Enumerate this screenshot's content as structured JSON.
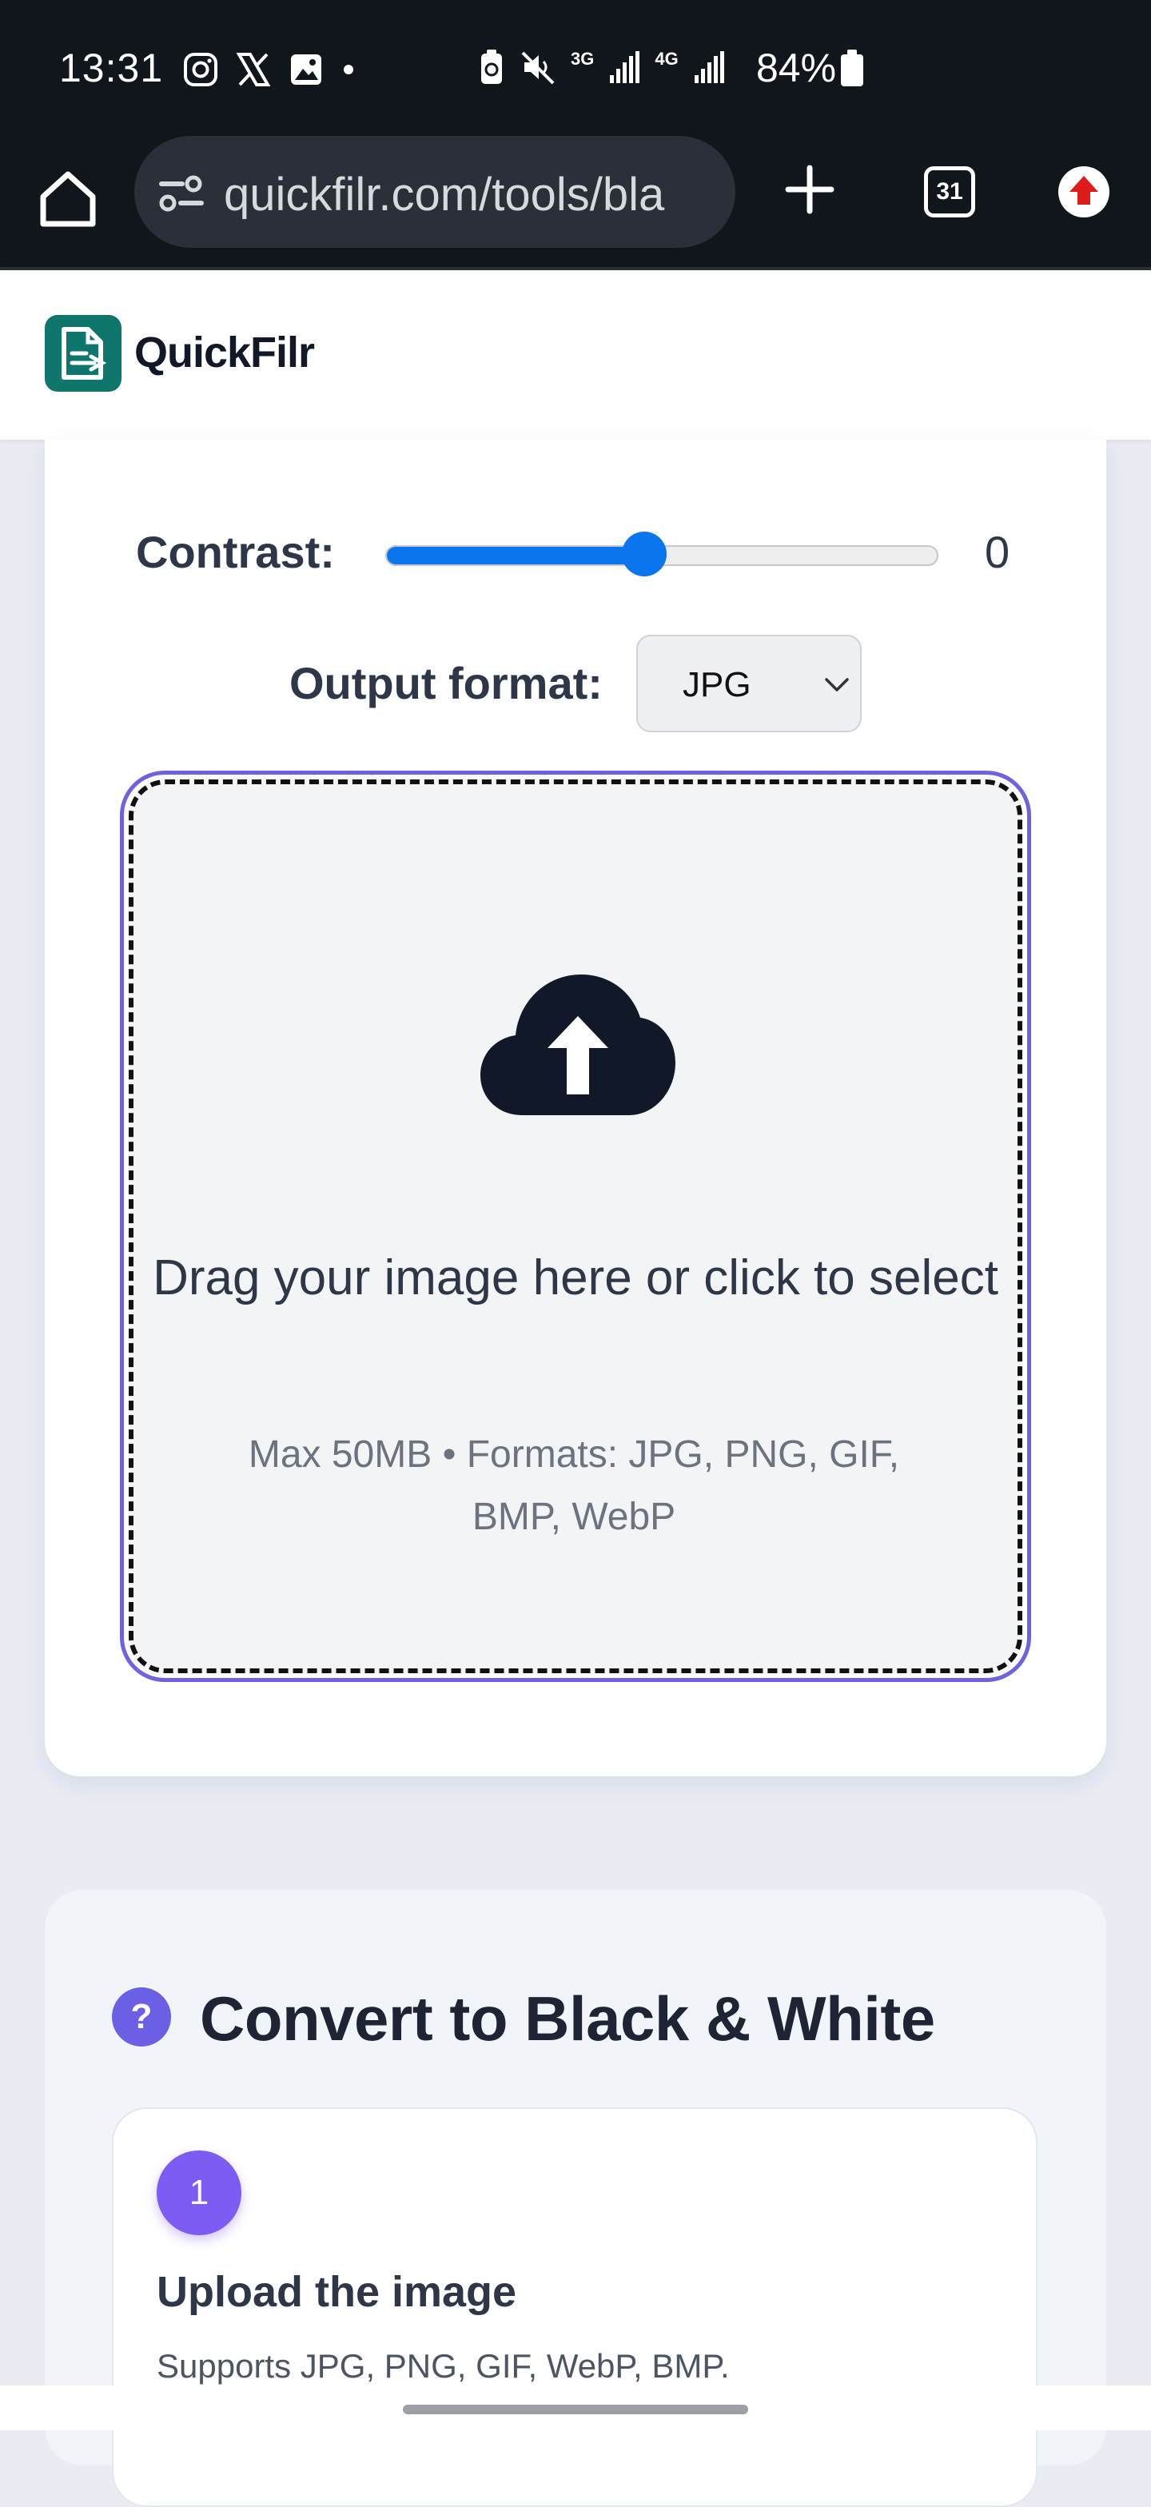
{
  "status_bar": {
    "time": "13:31",
    "battery": "84%",
    "network_3g": "3G",
    "network_4g": "4G"
  },
  "browser": {
    "url": "quickfilr.com/tools/bla",
    "tab_count": "31"
  },
  "site": {
    "brand": "QuickFilr"
  },
  "tool": {
    "contrast_label": "Contrast:",
    "contrast_value": "0",
    "contrast_slider_fraction": 0.5,
    "format_label": "Output format:",
    "format_selected": "JPG",
    "drop_title": "Drag your image here or click to select",
    "drop_hint": "Max 50MB • Formats: JPG, PNG, GIF, BMP, WebP"
  },
  "howto": {
    "help_icon_glyph": "?",
    "title": "Convert to Black & White",
    "steps": [
      {
        "number": "1",
        "title": "Upload the image",
        "description": "Supports JPG, PNG, GIF, WebP, BMP."
      }
    ]
  },
  "colors": {
    "accent_purple": "#6d63e0",
    "slider_blue": "#0b75ef",
    "brand_teal": "#0f766e"
  }
}
